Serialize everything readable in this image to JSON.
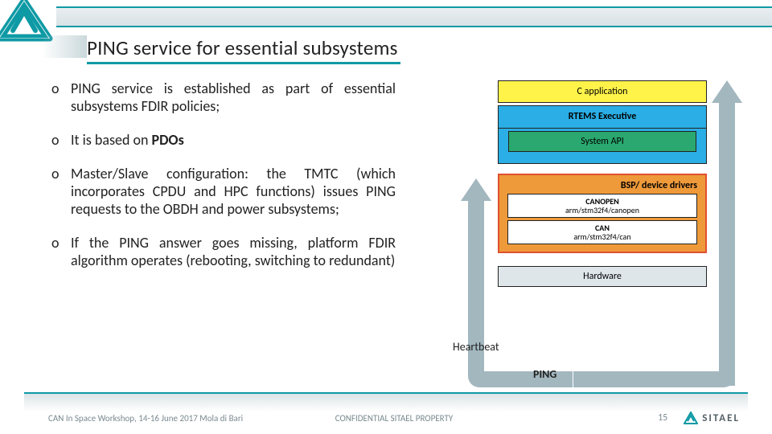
{
  "title": "PING service for essential subsystems",
  "bullets": [
    {
      "pre": "PING service is established as part of essential subsystems FDIR policies;",
      "bold": "",
      "post": ""
    },
    {
      "pre": "It is based on ",
      "bold": "PDOs",
      "post": ""
    },
    {
      "pre": "Master/Slave configuration: the TMTC (which incorporates CPDU and HPC functions) issues PING requests to the OBDH and power subsystems;",
      "bold": "",
      "post": ""
    },
    {
      "pre": "If the PING answer goes missing, platform FDIR algorithm operates (rebooting, switching to redundant)",
      "bold": "",
      "post": ""
    }
  ],
  "diagram": {
    "c_app": "C application",
    "rtems": "RTEMS Executive",
    "sysapi": "System API",
    "bsp": "BSP/ device drivers",
    "canopen_t": "CANOPEN",
    "canopen_s": "arm/stm32f4/canopen",
    "can_t": "CAN",
    "can_s": "arm/stm32f4/can",
    "hw": "Hardware",
    "heartbeat": "Heartbeat",
    "ping": "PING"
  },
  "footer": {
    "left": "CAN In Space Workshop, 14-16 June 2017 Mola di Bari",
    "center": "CONFIDENTIAL SITAEL PROPERTY",
    "page": "15",
    "brand": "SITAEL"
  }
}
